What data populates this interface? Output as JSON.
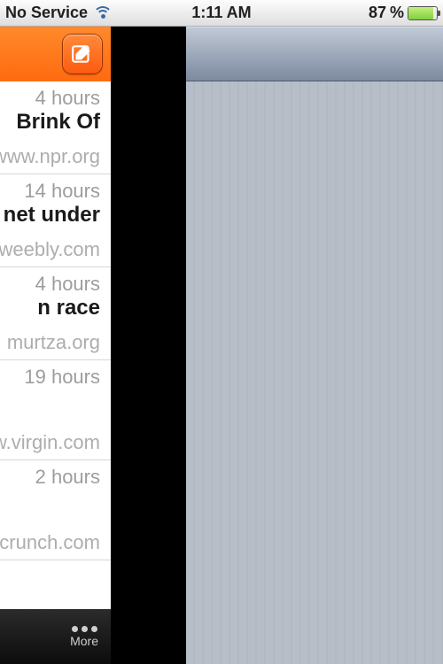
{
  "statusbar": {
    "service": "No Service",
    "time": "1:11 AM",
    "battery_pct": "87",
    "battery_suffix": "%"
  },
  "leftcard": {
    "items": [
      {
        "time": "4 hours",
        "title": "Brink Of",
        "source": "www.npr.org"
      },
      {
        "time": "14 hours",
        "title": "net under",
        "source": ".weebly.com"
      },
      {
        "time": "4 hours",
        "title": "n race",
        "source": "murtza.org"
      },
      {
        "time": "19 hours",
        "title": "",
        "source": "w.virgin.com"
      },
      {
        "time": "2 hours",
        "title": "",
        "source": "ncrunch.com"
      }
    ],
    "tabs": {
      "more": "More"
    }
  }
}
